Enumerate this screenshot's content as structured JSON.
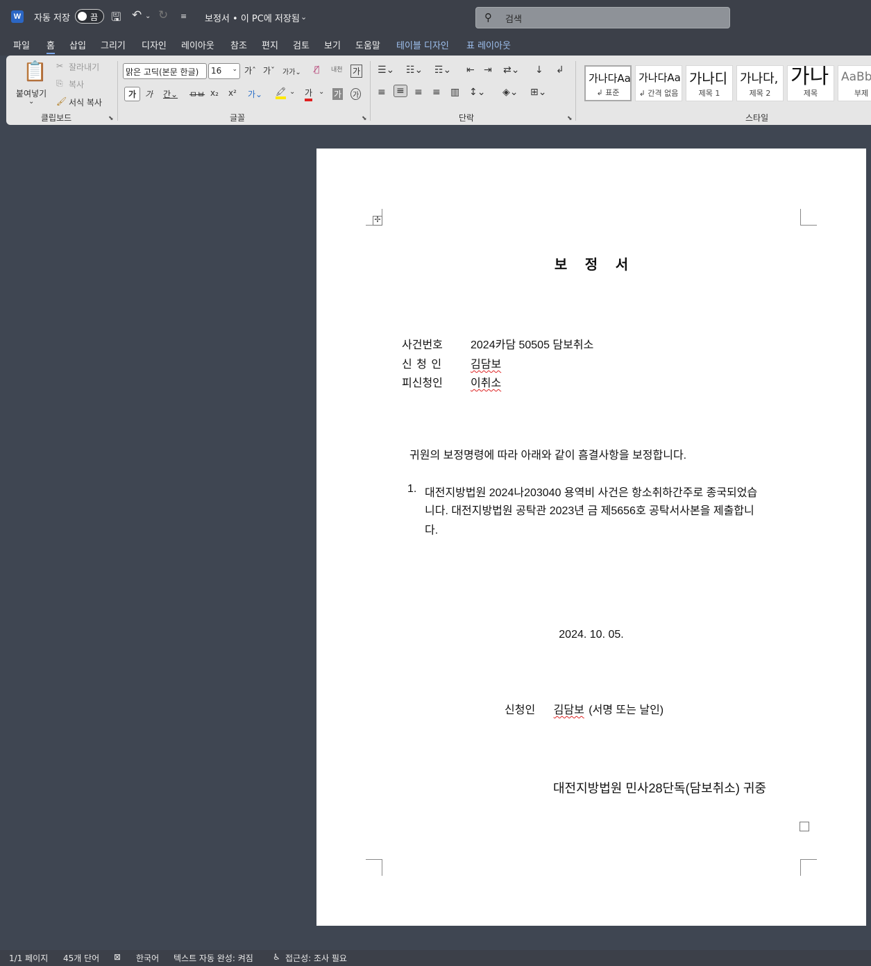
{
  "titlebar": {
    "autosave_label": "자동 저장",
    "autosave_state": "끔",
    "document_title": "보정서 • 이 PC에 저장됨",
    "search_placeholder": "검색"
  },
  "menu": {
    "tabs": [
      "파일",
      "홈",
      "삽입",
      "그리기",
      "디자인",
      "레이아웃",
      "참조",
      "편지",
      "검토",
      "보기",
      "도움말",
      "테이블 디자인",
      "표 레이아웃"
    ],
    "active": "홈"
  },
  "ribbon": {
    "clipboard": {
      "paste": "붙여넣기",
      "cut": "잘라내기",
      "copy": "복사",
      "format_painter": "서식 복사",
      "label": "클립보드"
    },
    "font": {
      "font_name": "맑은 고딕(본문 한글)",
      "font_size": "16",
      "label": "글꼴"
    },
    "paragraph": {
      "label": "단락"
    },
    "styles": {
      "label": "스타일",
      "items": [
        {
          "preview": "가나다Aa",
          "name": "↲ 표준"
        },
        {
          "preview": "가나다Aa",
          "name": "↲ 간격 없음"
        },
        {
          "preview": "가나디",
          "name": "제목 1"
        },
        {
          "preview": "가나다,",
          "name": "제목 2"
        },
        {
          "preview": "가나",
          "name": "제목"
        },
        {
          "preview": "AaBb",
          "name": "부제"
        }
      ]
    }
  },
  "document": {
    "title": "보 정 서",
    "case_number_label": "사건번호",
    "case_number_value": "2024카담 50505 담보취소",
    "applicant_label": "신 청 인",
    "applicant_value": "김담보",
    "respondent_label": "피신청인",
    "respondent_value": "이취소",
    "intro": "귀원의 보정명령에 따라 아래와 같이 흠결사항을 보정합니다.",
    "item_number": "1.",
    "item_line1": "대전지방법원 2024나203040 용역비 사건은 항소취하간주로 종국되었습",
    "item_line2": "니다. 대전지방법원 공탁관 2023년 금 제5656호 공탁서사본을 제출합니",
    "item_line3": "다.",
    "date": "2024. 10. 05.",
    "signature_label": "신청인",
    "signature_name": "김담보",
    "signature_note": "(서명 또는 날인)",
    "court": "대전지방법원 민사28단독(담보취소) 귀중"
  },
  "statusbar": {
    "page": "1/1 페이지",
    "words": "45개 단어",
    "language": "한국어",
    "autocomplete": "텍스트 자동 완성: 켜짐",
    "accessibility": "접근성: 조사 필요"
  }
}
